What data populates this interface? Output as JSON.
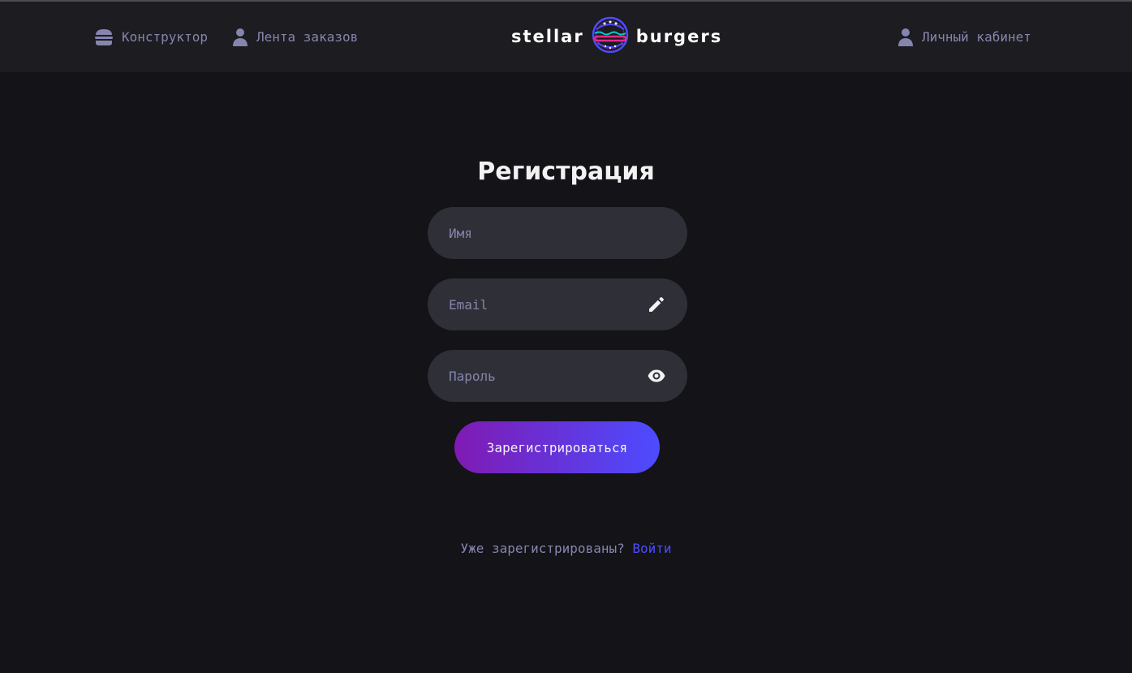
{
  "header": {
    "nav": {
      "constructor": "Конструктор",
      "feed": "Лента заказов",
      "account": "Личный кабинет"
    },
    "logo": {
      "left": "stellar",
      "right": "burgers"
    }
  },
  "form": {
    "title": "Регистрация",
    "name_placeholder": "Имя",
    "email_placeholder": "Email",
    "password_placeholder": "Пароль",
    "submit_label": "Зарегистрироваться",
    "already_text": "Уже зарегистрированы?",
    "login_link": "Войти"
  },
  "icons": {
    "constructor": "burger-icon",
    "feed": "list-icon",
    "account": "profile-icon",
    "email_action": "edit-icon",
    "password_action": "show-password-icon"
  },
  "colors": {
    "background": "#131318",
    "header": "#1c1c21",
    "input": "#2f2f37",
    "inactive_text": "#8585ad",
    "accent": "#4c4cff",
    "button_gradient_start": "#801ab3",
    "button_gradient_end": "#4c4cff"
  }
}
